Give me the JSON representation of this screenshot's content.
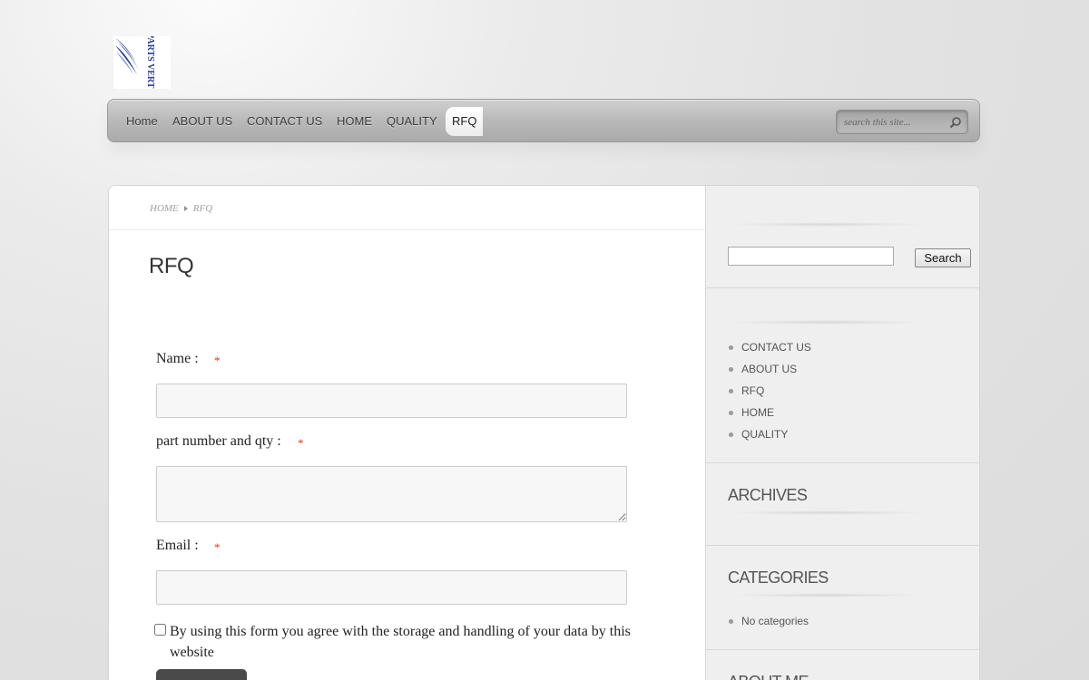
{
  "logo": {
    "text": "PARTS VERTICAL"
  },
  "nav": {
    "items": [
      {
        "label": "Home"
      },
      {
        "label": "ABOUT US"
      },
      {
        "label": "CONTACT US"
      },
      {
        "label": "HOME"
      },
      {
        "label": "QUALITY"
      },
      {
        "label": "RFQ",
        "active": true
      }
    ],
    "search_placeholder": "search this site..."
  },
  "breadcrumb": {
    "home": "HOME",
    "current": "RFQ"
  },
  "page": {
    "title": "RFQ"
  },
  "form": {
    "name_label": "Name :",
    "part_label": "part number and qty :",
    "email_label": "Email :",
    "required_mark": "*",
    "name_value": "",
    "part_value": "",
    "email_value": "",
    "consent_text": "By using this form you agree with the storage and handling of your data by this website",
    "consent_checked": false
  },
  "sidebar": {
    "search_button": "Search",
    "search_value": "",
    "pages": [
      "CONTACT US",
      "ABOUT US",
      "RFQ",
      "HOME",
      "QUALITY"
    ],
    "archives_title": "ARCHIVES",
    "categories_title": "CATEGORIES",
    "categories_empty": "No categories",
    "about_title": "ABOUT ME"
  },
  "colors": {
    "required": "#dd3322",
    "submit_button": "#4a4a4a",
    "logo_blue": "#2b3e86"
  }
}
